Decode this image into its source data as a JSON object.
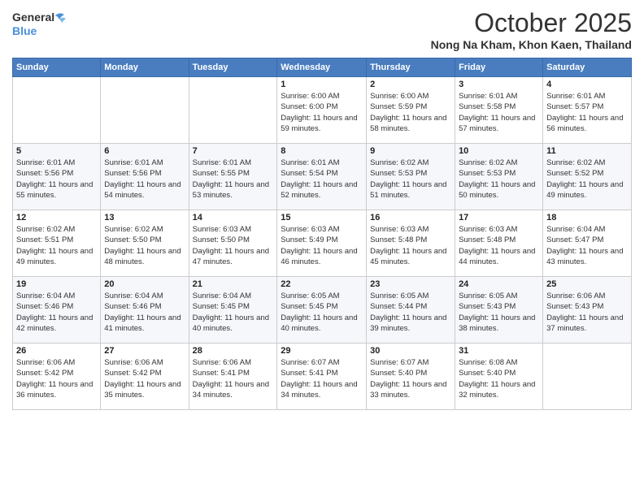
{
  "logo": {
    "line1": "General",
    "line2": "Blue"
  },
  "title": "October 2025",
  "location": "Nong Na Kham, Khon Kaen, Thailand",
  "days_of_week": [
    "Sunday",
    "Monday",
    "Tuesday",
    "Wednesday",
    "Thursday",
    "Friday",
    "Saturday"
  ],
  "weeks": [
    [
      {
        "day": "",
        "sunrise": "",
        "sunset": "",
        "daylight": ""
      },
      {
        "day": "",
        "sunrise": "",
        "sunset": "",
        "daylight": ""
      },
      {
        "day": "",
        "sunrise": "",
        "sunset": "",
        "daylight": ""
      },
      {
        "day": "1",
        "sunrise": "Sunrise: 6:00 AM",
        "sunset": "Sunset: 6:00 PM",
        "daylight": "Daylight: 11 hours and 59 minutes."
      },
      {
        "day": "2",
        "sunrise": "Sunrise: 6:00 AM",
        "sunset": "Sunset: 5:59 PM",
        "daylight": "Daylight: 11 hours and 58 minutes."
      },
      {
        "day": "3",
        "sunrise": "Sunrise: 6:01 AM",
        "sunset": "Sunset: 5:58 PM",
        "daylight": "Daylight: 11 hours and 57 minutes."
      },
      {
        "day": "4",
        "sunrise": "Sunrise: 6:01 AM",
        "sunset": "Sunset: 5:57 PM",
        "daylight": "Daylight: 11 hours and 56 minutes."
      }
    ],
    [
      {
        "day": "5",
        "sunrise": "Sunrise: 6:01 AM",
        "sunset": "Sunset: 5:56 PM",
        "daylight": "Daylight: 11 hours and 55 minutes."
      },
      {
        "day": "6",
        "sunrise": "Sunrise: 6:01 AM",
        "sunset": "Sunset: 5:56 PM",
        "daylight": "Daylight: 11 hours and 54 minutes."
      },
      {
        "day": "7",
        "sunrise": "Sunrise: 6:01 AM",
        "sunset": "Sunset: 5:55 PM",
        "daylight": "Daylight: 11 hours and 53 minutes."
      },
      {
        "day": "8",
        "sunrise": "Sunrise: 6:01 AM",
        "sunset": "Sunset: 5:54 PM",
        "daylight": "Daylight: 11 hours and 52 minutes."
      },
      {
        "day": "9",
        "sunrise": "Sunrise: 6:02 AM",
        "sunset": "Sunset: 5:53 PM",
        "daylight": "Daylight: 11 hours and 51 minutes."
      },
      {
        "day": "10",
        "sunrise": "Sunrise: 6:02 AM",
        "sunset": "Sunset: 5:53 PM",
        "daylight": "Daylight: 11 hours and 50 minutes."
      },
      {
        "day": "11",
        "sunrise": "Sunrise: 6:02 AM",
        "sunset": "Sunset: 5:52 PM",
        "daylight": "Daylight: 11 hours and 49 minutes."
      }
    ],
    [
      {
        "day": "12",
        "sunrise": "Sunrise: 6:02 AM",
        "sunset": "Sunset: 5:51 PM",
        "daylight": "Daylight: 11 hours and 49 minutes."
      },
      {
        "day": "13",
        "sunrise": "Sunrise: 6:02 AM",
        "sunset": "Sunset: 5:50 PM",
        "daylight": "Daylight: 11 hours and 48 minutes."
      },
      {
        "day": "14",
        "sunrise": "Sunrise: 6:03 AM",
        "sunset": "Sunset: 5:50 PM",
        "daylight": "Daylight: 11 hours and 47 minutes."
      },
      {
        "day": "15",
        "sunrise": "Sunrise: 6:03 AM",
        "sunset": "Sunset: 5:49 PM",
        "daylight": "Daylight: 11 hours and 46 minutes."
      },
      {
        "day": "16",
        "sunrise": "Sunrise: 6:03 AM",
        "sunset": "Sunset: 5:48 PM",
        "daylight": "Daylight: 11 hours and 45 minutes."
      },
      {
        "day": "17",
        "sunrise": "Sunrise: 6:03 AM",
        "sunset": "Sunset: 5:48 PM",
        "daylight": "Daylight: 11 hours and 44 minutes."
      },
      {
        "day": "18",
        "sunrise": "Sunrise: 6:04 AM",
        "sunset": "Sunset: 5:47 PM",
        "daylight": "Daylight: 11 hours and 43 minutes."
      }
    ],
    [
      {
        "day": "19",
        "sunrise": "Sunrise: 6:04 AM",
        "sunset": "Sunset: 5:46 PM",
        "daylight": "Daylight: 11 hours and 42 minutes."
      },
      {
        "day": "20",
        "sunrise": "Sunrise: 6:04 AM",
        "sunset": "Sunset: 5:46 PM",
        "daylight": "Daylight: 11 hours and 41 minutes."
      },
      {
        "day": "21",
        "sunrise": "Sunrise: 6:04 AM",
        "sunset": "Sunset: 5:45 PM",
        "daylight": "Daylight: 11 hours and 40 minutes."
      },
      {
        "day": "22",
        "sunrise": "Sunrise: 6:05 AM",
        "sunset": "Sunset: 5:45 PM",
        "daylight": "Daylight: 11 hours and 40 minutes."
      },
      {
        "day": "23",
        "sunrise": "Sunrise: 6:05 AM",
        "sunset": "Sunset: 5:44 PM",
        "daylight": "Daylight: 11 hours and 39 minutes."
      },
      {
        "day": "24",
        "sunrise": "Sunrise: 6:05 AM",
        "sunset": "Sunset: 5:43 PM",
        "daylight": "Daylight: 11 hours and 38 minutes."
      },
      {
        "day": "25",
        "sunrise": "Sunrise: 6:06 AM",
        "sunset": "Sunset: 5:43 PM",
        "daylight": "Daylight: 11 hours and 37 minutes."
      }
    ],
    [
      {
        "day": "26",
        "sunrise": "Sunrise: 6:06 AM",
        "sunset": "Sunset: 5:42 PM",
        "daylight": "Daylight: 11 hours and 36 minutes."
      },
      {
        "day": "27",
        "sunrise": "Sunrise: 6:06 AM",
        "sunset": "Sunset: 5:42 PM",
        "daylight": "Daylight: 11 hours and 35 minutes."
      },
      {
        "day": "28",
        "sunrise": "Sunrise: 6:06 AM",
        "sunset": "Sunset: 5:41 PM",
        "daylight": "Daylight: 11 hours and 34 minutes."
      },
      {
        "day": "29",
        "sunrise": "Sunrise: 6:07 AM",
        "sunset": "Sunset: 5:41 PM",
        "daylight": "Daylight: 11 hours and 34 minutes."
      },
      {
        "day": "30",
        "sunrise": "Sunrise: 6:07 AM",
        "sunset": "Sunset: 5:40 PM",
        "daylight": "Daylight: 11 hours and 33 minutes."
      },
      {
        "day": "31",
        "sunrise": "Sunrise: 6:08 AM",
        "sunset": "Sunset: 5:40 PM",
        "daylight": "Daylight: 11 hours and 32 minutes."
      },
      {
        "day": "",
        "sunrise": "",
        "sunset": "",
        "daylight": ""
      }
    ]
  ]
}
